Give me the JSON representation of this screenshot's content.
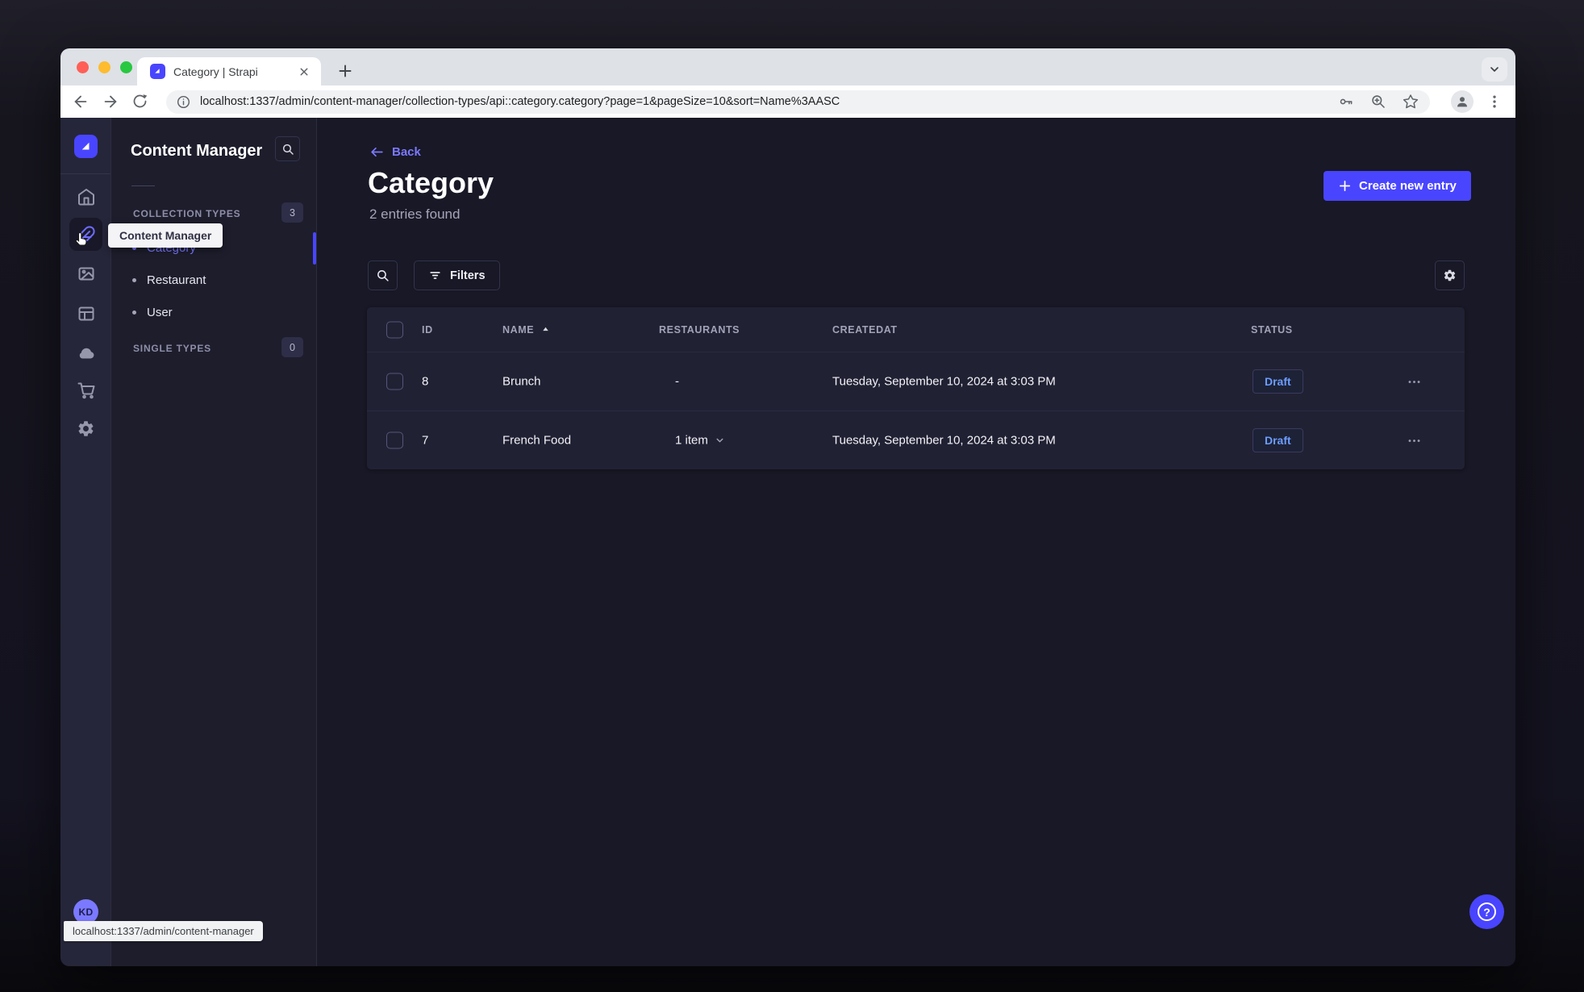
{
  "browser": {
    "tab_title": "Category | Strapi",
    "url": "localhost:1337/admin/content-manager/collection-types/api::category.category?page=1&pageSize=10&sort=Name%3AASC",
    "status_bubble": "localhost:1337/admin/content-manager"
  },
  "sidebar": {
    "tooltip": "Content Manager",
    "avatar_initials": "KD",
    "icons": [
      "home",
      "content-manager",
      "media-library",
      "content-type-builder",
      "cloud",
      "marketplace",
      "settings"
    ]
  },
  "subnav": {
    "title": "Content Manager",
    "sections": [
      {
        "label": "COLLECTION TYPES",
        "badge": "3",
        "items": [
          {
            "label": "Category",
            "active": true
          },
          {
            "label": "Restaurant",
            "active": false
          },
          {
            "label": "User",
            "active": false
          }
        ]
      },
      {
        "label": "SINGLE TYPES",
        "badge": "0",
        "items": []
      }
    ]
  },
  "main": {
    "back_label": "Back",
    "title": "Category",
    "subtitle": "2 entries found",
    "create_button_label": "Create new entry",
    "filters_button_label": "Filters",
    "help_label": "?",
    "table": {
      "headers": [
        "ID",
        "NAME",
        "RESTAURANTS",
        "CREATEDAT",
        "STATUS"
      ],
      "sorted_by": "NAME",
      "sort_direction": "asc",
      "rows": [
        {
          "id": "8",
          "name": "Brunch",
          "restaurants": "-",
          "createdat": "Tuesday, September 10, 2024 at 3:03 PM",
          "status": "Draft"
        },
        {
          "id": "7",
          "name": "French Food",
          "restaurants": "1 item",
          "createdat": "Tuesday, September 10, 2024 at 3:03 PM",
          "status": "Draft"
        }
      ]
    }
  },
  "colors": {
    "primary": "#4945ff",
    "primary_light": "#7b79ff",
    "draft_text": "#6c9cff"
  }
}
